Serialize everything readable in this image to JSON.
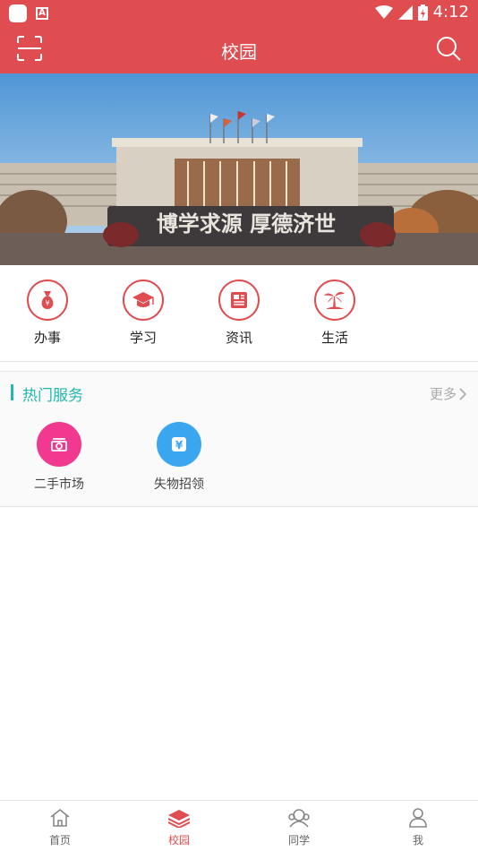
{
  "status_bar": {
    "time": "4:12",
    "battery_glyph": "⚡"
  },
  "app_bar": {
    "title": "校园",
    "icons": {
      "left": "scan-icon",
      "right": "search-icon"
    }
  },
  "banner": {
    "motto": "博学求源 厚德济世"
  },
  "quick_actions": [
    {
      "label": "办事",
      "icon": "money-bag-icon"
    },
    {
      "label": "学习",
      "icon": "graduation-cap-icon"
    },
    {
      "label": "资讯",
      "icon": "news-icon"
    },
    {
      "label": "生活",
      "icon": "palm-tree-icon"
    }
  ],
  "hot_services": {
    "title": "热门服务",
    "more": "更多",
    "items": [
      {
        "label": "二手市场",
        "icon": "market-icon",
        "color": "#f0398f"
      },
      {
        "label": "失物招领",
        "icon": "lost-found-icon",
        "color": "#3aa6f0"
      }
    ]
  },
  "tab_bar": {
    "items": [
      {
        "label": "首页",
        "icon": "home-icon",
        "active": false
      },
      {
        "label": "校园",
        "icon": "campus-icon",
        "active": true
      },
      {
        "label": "同学",
        "icon": "classmates-icon",
        "active": false
      },
      {
        "label": "我",
        "icon": "person-icon",
        "active": false
      }
    ]
  },
  "colors": {
    "primary": "#e04d50",
    "accent": "#20b8b0"
  }
}
